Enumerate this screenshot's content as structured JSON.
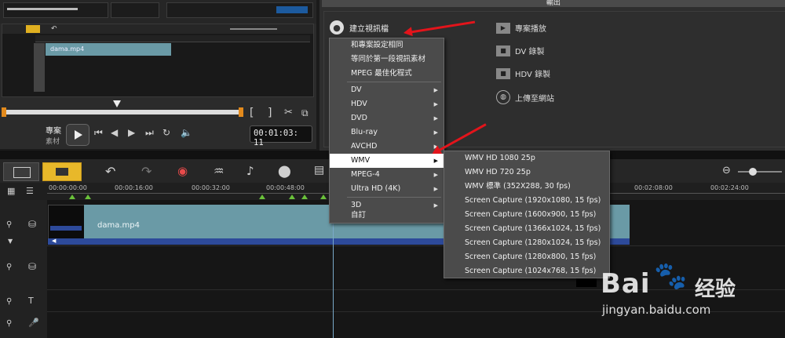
{
  "output_panel": {
    "header": "輸出",
    "create_video": "建立視訊檔",
    "right_options": [
      "專案播放",
      "DV 錄製",
      "HDV 錄製",
      "上傳至網站"
    ]
  },
  "preview": {
    "project_label": "專案",
    "clip_label": "素材",
    "timecode": "00:01:03: 11"
  },
  "timeline": {
    "ruler_ticks": [
      "00:00:00:00",
      "00:00:16:00",
      "00:00:32:00",
      "00:00:48:00",
      "00:02:08:00",
      "00:02:24:00"
    ],
    "clip_name": "dama.mp4",
    "mini_clip_name": "dama.mp4"
  },
  "context_menu": {
    "items": [
      {
        "label": "和專案設定相同",
        "submenu": false
      },
      {
        "label": "等同於第一段視訊素材",
        "submenu": false
      },
      {
        "label": "MPEG 最佳化程式",
        "submenu": false
      },
      {
        "label": "DV",
        "submenu": true
      },
      {
        "label": "HDV",
        "submenu": true
      },
      {
        "label": "DVD",
        "submenu": true
      },
      {
        "label": "Blu-ray",
        "submenu": true
      },
      {
        "label": "AVCHD",
        "submenu": true
      },
      {
        "label": "WMV",
        "submenu": true
      },
      {
        "label": "MPEG-4",
        "submenu": true
      },
      {
        "label": "Ultra HD (4K)",
        "submenu": true
      },
      {
        "label": "3D",
        "submenu": true
      },
      {
        "label": "自訂",
        "submenu": false
      }
    ]
  },
  "wmv_submenu": {
    "items": [
      "WMV HD 1080 25p",
      "WMV HD 720 25p",
      "WMV 標準 (352X288, 30 fps)",
      "Screen Capture (1920x1080, 15 fps)",
      "Screen Capture (1600x900, 15 fps)",
      "Screen Capture (1366x1024, 15 fps)",
      "Screen Capture (1280x1024, 15 fps)",
      "Screen Capture (1280x800, 15 fps)",
      "Screen Capture (1024x768, 15 fps)"
    ]
  },
  "watermark": {
    "brand": "Bai",
    "brand_suffix": "经验",
    "url": "jingyan.baidu.com"
  },
  "colors": {
    "accent_orange": "#e38a1c",
    "arrow_red": "#e3141b",
    "clip_teal": "#6a9aa6",
    "audio_blue": "#2d4a9a"
  }
}
